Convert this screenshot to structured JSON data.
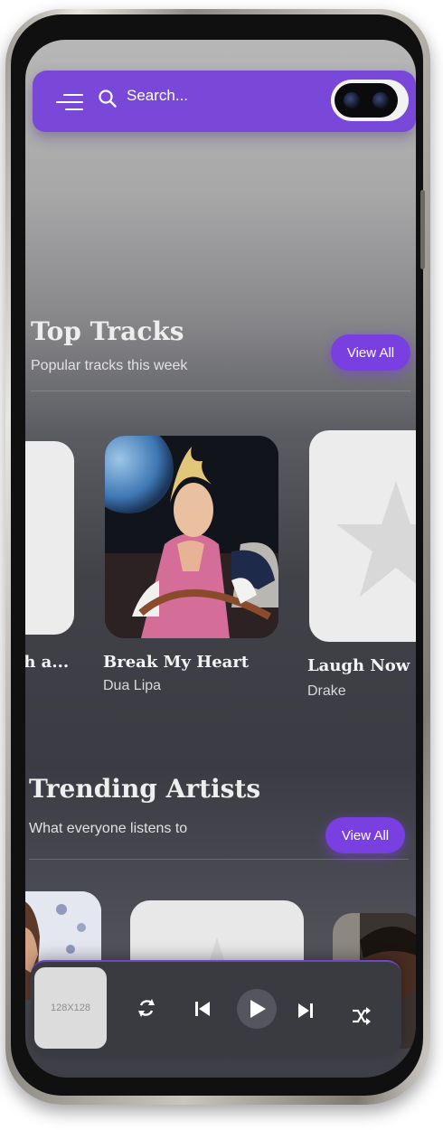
{
  "search": {
    "placeholder": "Search..."
  },
  "top_tracks": {
    "title": "Top Tracks",
    "subtitle": "Popular tracks this week",
    "view_all": "View All",
    "items": [
      {
        "title": "th a...",
        "artist": ""
      },
      {
        "title": "Break My Heart",
        "artist": "Dua Lipa"
      },
      {
        "title": "Laugh Now Cr",
        "artist": "Drake"
      }
    ]
  },
  "trending_artists": {
    "title": "Trending Artists",
    "subtitle": "What everyone listens to",
    "view_all": "View All"
  },
  "player": {
    "thumb_label": "128X128",
    "icons": [
      "repeat-icon",
      "skip-previous-icon",
      "play-icon",
      "skip-next-icon",
      "shuffle-icon"
    ]
  },
  "colors": {
    "accent": "#7a48d9",
    "button": "#7a3fe0",
    "player_bg": "#3a3a41"
  }
}
